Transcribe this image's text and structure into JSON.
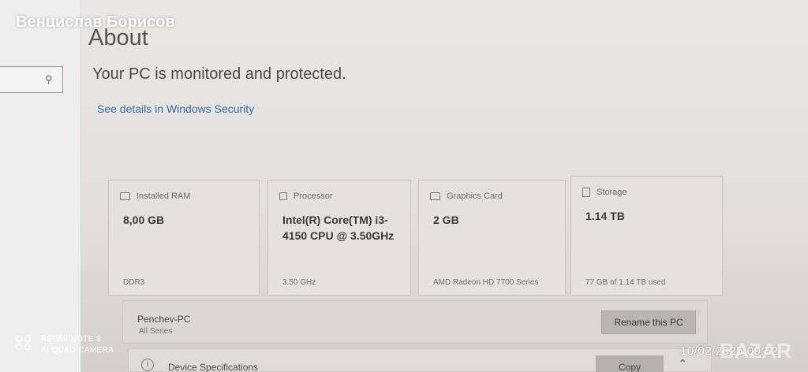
{
  "overlay_name": "Венцислав Борисов",
  "page": {
    "title": "About",
    "protection_status": "Your PC is monitored and protected.",
    "security_link": "See details in Windows Security"
  },
  "specs": [
    {
      "label": "Installed RAM",
      "icon": "ram-icon",
      "value": "8,00 GB",
      "sub": "DDR3"
    },
    {
      "label": "Processor",
      "icon": "processor-icon",
      "value": "Intel(R) Core(TM) i3-4150 CPU @ 3.50GHz",
      "sub": "3.50 GHz"
    },
    {
      "label": "Graphics Card",
      "icon": "graphics-card-icon",
      "value": "2 GB",
      "sub": "AMD Radeon HD 7700 Series"
    },
    {
      "label": "Storage",
      "icon": "storage-icon",
      "value": "1.14 TB",
      "sub": "77 GB of 1.14 TB used"
    }
  ],
  "device": {
    "name": "Penchev-PC",
    "series": "All Series",
    "rename_label": "Rename this PC"
  },
  "device_specifications": {
    "label": "Device Specifications",
    "copy_label": "Copy"
  },
  "camera_watermark": {
    "line1": "REDMI NOTE 8",
    "line2": "AI QUAD CAMERA"
  },
  "timestamp": "10/02/2025 09:52",
  "bazar_mark": "BAZAR"
}
